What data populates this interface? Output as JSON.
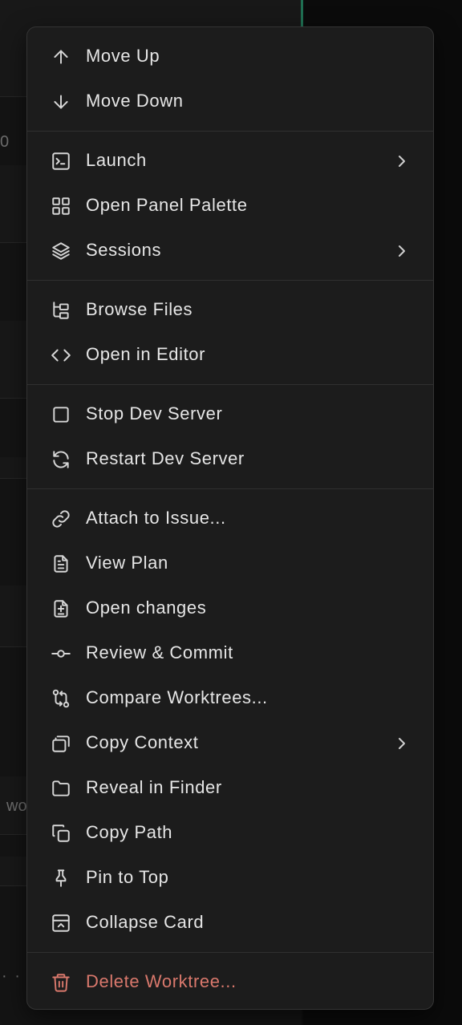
{
  "background": {
    "snippet_top": "0",
    "snippet_mid": "wo",
    "snippet_bottom": "· ·"
  },
  "menu": {
    "items": [
      {
        "label": "Move Up",
        "icon": "arrow-up-icon"
      },
      {
        "label": "Move Down",
        "icon": "arrow-down-icon"
      },
      {
        "label": "Launch",
        "icon": "terminal-icon",
        "submenu": true
      },
      {
        "label": "Open Panel Palette",
        "icon": "grid-icon"
      },
      {
        "label": "Sessions",
        "icon": "layers-icon",
        "submenu": true
      },
      {
        "label": "Browse Files",
        "icon": "folder-tree-icon"
      },
      {
        "label": "Open in Editor",
        "icon": "code-icon"
      },
      {
        "label": "Stop Dev Server",
        "icon": "stop-square-icon"
      },
      {
        "label": "Restart Dev Server",
        "icon": "refresh-icon"
      },
      {
        "label": "Attach to Issue...",
        "icon": "link-icon"
      },
      {
        "label": "View Plan",
        "icon": "document-icon"
      },
      {
        "label": "Open changes",
        "icon": "file-diff-icon"
      },
      {
        "label": "Review & Commit",
        "icon": "git-commit-icon"
      },
      {
        "label": "Compare Worktrees...",
        "icon": "git-compare-icon"
      },
      {
        "label": "Copy Context",
        "icon": "copy-stack-icon",
        "submenu": true
      },
      {
        "label": "Reveal in Finder",
        "icon": "folder-icon"
      },
      {
        "label": "Copy Path",
        "icon": "copy-icon"
      },
      {
        "label": "Pin to Top",
        "icon": "pin-icon"
      },
      {
        "label": "Collapse Card",
        "icon": "collapse-card-icon"
      },
      {
        "label": "Delete Worktree...",
        "icon": "trash-icon",
        "danger": true
      }
    ]
  },
  "colors": {
    "menu_bg": "#1c1c1c",
    "text": "#e6e6e6",
    "danger": "#d9786c",
    "separator": "#303030",
    "accent_divider": "#1f6f52"
  }
}
